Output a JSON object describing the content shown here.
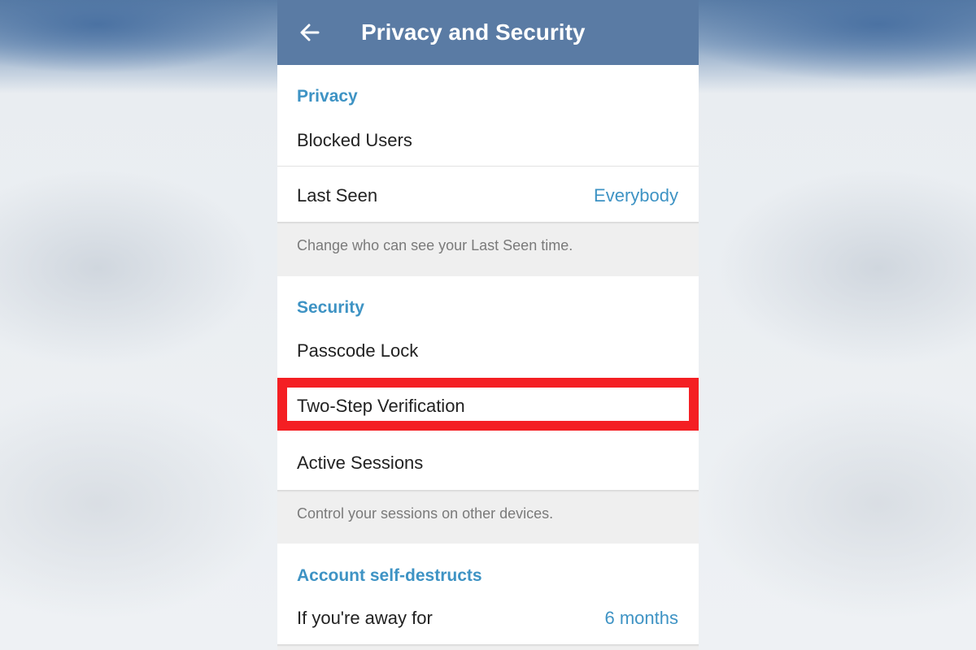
{
  "appbar": {
    "title": "Privacy and Security",
    "back_icon": "arrow-left-icon",
    "color": "#5a7ba4"
  },
  "privacy": {
    "header": "Privacy",
    "blocked_users_label": "Blocked Users",
    "last_seen_label": "Last Seen",
    "last_seen_value": "Everybody",
    "hint": "Change who can see your Last Seen time."
  },
  "security": {
    "header": "Security",
    "passcode_lock_label": "Passcode Lock",
    "two_step_label": "Two-Step Verification",
    "active_sessions_label": "Active Sessions",
    "hint": "Control your sessions on other devices."
  },
  "self_destruct": {
    "header": "Account self-destructs",
    "away_label": "If you're away for",
    "away_value": "6 months"
  },
  "colors": {
    "accent": "#3e93c4",
    "highlight_border": "#f41f23"
  }
}
